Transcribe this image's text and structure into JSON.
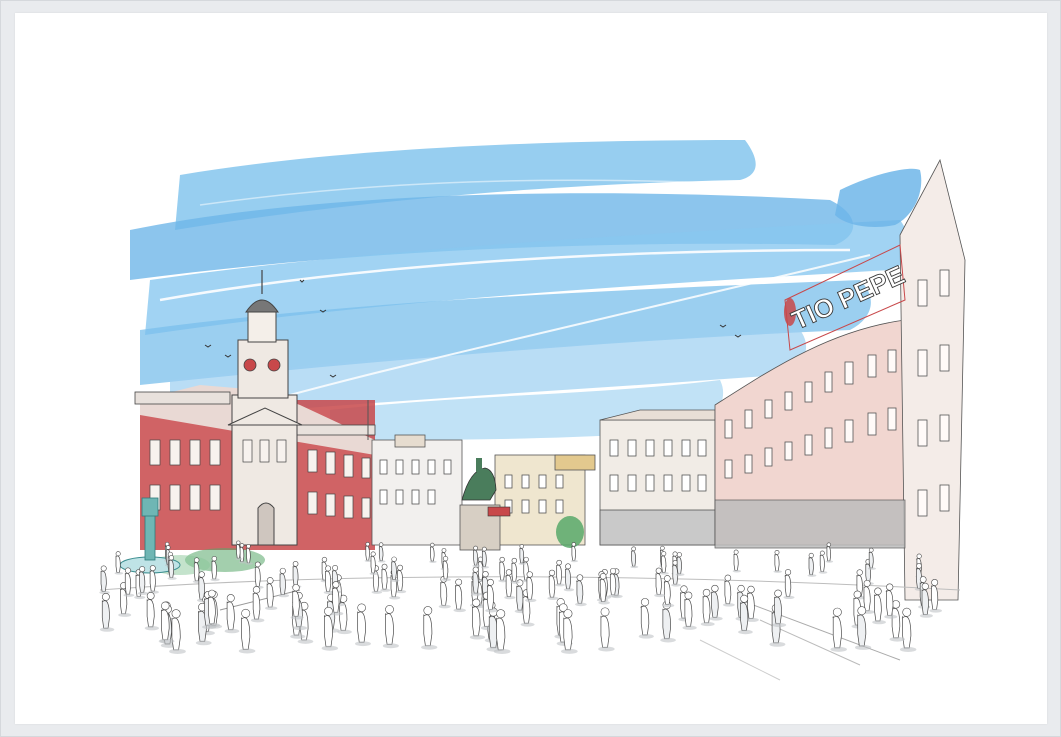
{
  "scene": {
    "sign_text": "TIO PEPE",
    "colors": {
      "sky": "#6cb8ea",
      "sky_light": "#a9d6f2",
      "red_facade": "#c8484a",
      "pink_facade": "#f1d6d0",
      "cream_facade": "#efe6cf",
      "tree_green": "#58a86a",
      "ink": "#3a3a3a",
      "crowd_shadow": "#bfc3c7"
    }
  }
}
